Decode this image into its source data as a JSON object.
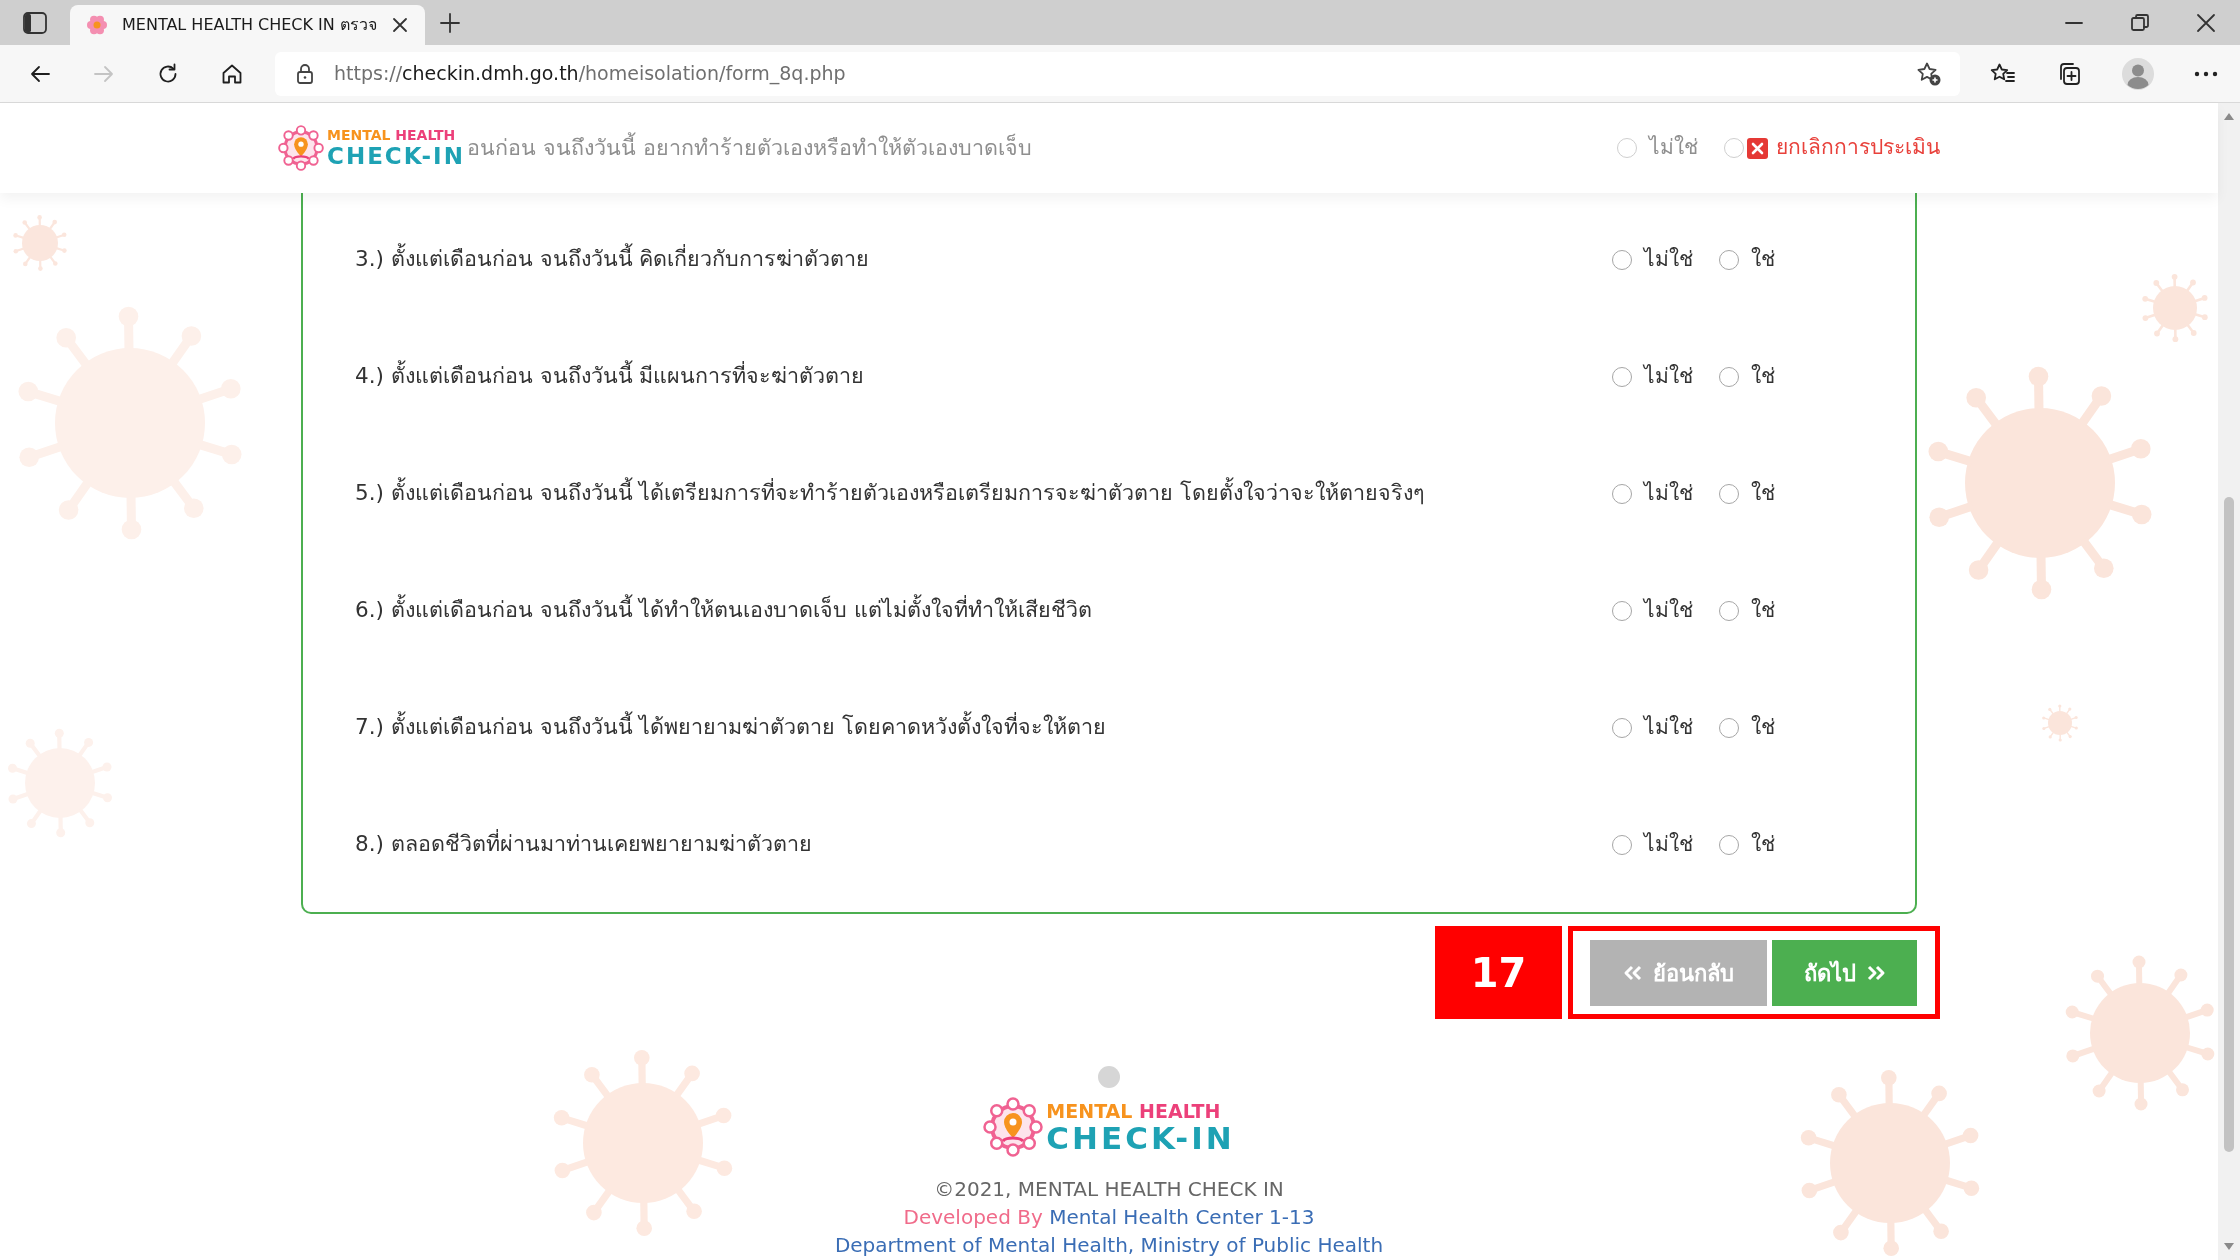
{
  "browser": {
    "tab": {
      "title": "MENTAL HEALTH CHECK IN ตรวจ"
    },
    "nav": [
      {
        "kind": "back",
        "disabled": false
      },
      {
        "kind": "forward",
        "disabled": true
      },
      {
        "kind": "refresh",
        "disabled": false
      },
      {
        "kind": "home",
        "disabled": false
      }
    ],
    "url": {
      "scheme": "https://",
      "host": "checkin.dmh.go.th",
      "path": "/homeisolation/form_8q.php"
    }
  },
  "header": {
    "logo": {
      "tagline": [
        "MENTAL",
        "HEALTH"
      ],
      "wordmark": "CHECK-IN"
    },
    "cancel": "ยกเลิกการประเมิน"
  },
  "covered_question": {
    "text": "อนก่อน จนถึงวันนี้ อยากทำร้ายตัวเองหรือทำให้ตัวเองบาดเจ็บ",
    "options": [
      {
        "label": "ไม่ใช่",
        "selected": false
      },
      {
        "selected": false
      }
    ]
  },
  "questions": [
    {
      "text": "3.) ตั้งแต่เดือนก่อน จนถึงวันนี้ คิดเกี่ยวกับการฆ่าตัวตาย",
      "options": [
        {
          "label": "ไม่ใช่",
          "selected": false
        },
        {
          "label": "ใช่",
          "selected": false
        }
      ]
    },
    {
      "text": "4.) ตั้งแต่เดือนก่อน จนถึงวันนี้ มีแผนการที่จะฆ่าตัวตาย",
      "options": [
        {
          "label": "ไม่ใช่",
          "selected": false
        },
        {
          "label": "ใช่",
          "selected": false
        }
      ]
    },
    {
      "text": "5.) ตั้งแต่เดือนก่อน จนถึงวันนี้ ได้เตรียมการที่จะทำร้ายตัวเองหรือเตรียมการจะฆ่าตัวตาย โดยตั้งใจว่าจะให้ตายจริงๆ",
      "options": [
        {
          "label": "ไม่ใช่",
          "selected": false
        },
        {
          "label": "ใช่",
          "selected": false
        }
      ]
    },
    {
      "text": "6.) ตั้งแต่เดือนก่อน จนถึงวันนี้ ได้ทำให้ตนเองบาดเจ็บ แต่ไม่ตั้งใจที่ทำให้เสียชีวิต",
      "options": [
        {
          "label": "ไม่ใช่",
          "selected": false
        },
        {
          "label": "ใช่",
          "selected": false
        }
      ]
    },
    {
      "text": "7.) ตั้งแต่เดือนก่อน จนถึงวันนี้ ได้พยายามฆ่าตัวตาย โดยคาดหวังตั้งใจที่จะให้ตาย",
      "options": [
        {
          "label": "ไม่ใช่",
          "selected": false
        },
        {
          "label": "ใช่",
          "selected": false
        }
      ]
    },
    {
      "text": "8.) ตลอดชีวิตที่ผ่านมาท่านเคยพยายามฆ่าตัวตาย",
      "options": [
        {
          "label": "ไม่ใช่",
          "selected": false
        },
        {
          "label": "ใช่",
          "selected": false
        }
      ]
    }
  ],
  "step_marker": "17",
  "buttons": [
    {
      "kind": "back",
      "label": "ย้อนกลับ"
    },
    {
      "kind": "next",
      "label": "ถัดไป"
    }
  ],
  "footer": {
    "logo": {
      "tagline": [
        "MENTAL",
        "HEALTH"
      ],
      "wordmark": "CHECK-IN"
    },
    "copyright": "©2021, MENTAL HEALTH CHECK IN",
    "credit_label": "Developed By",
    "credit_link": "Mental Health Center 1-13",
    "department": "Department of Mental Health, Ministry of Public Health"
  }
}
